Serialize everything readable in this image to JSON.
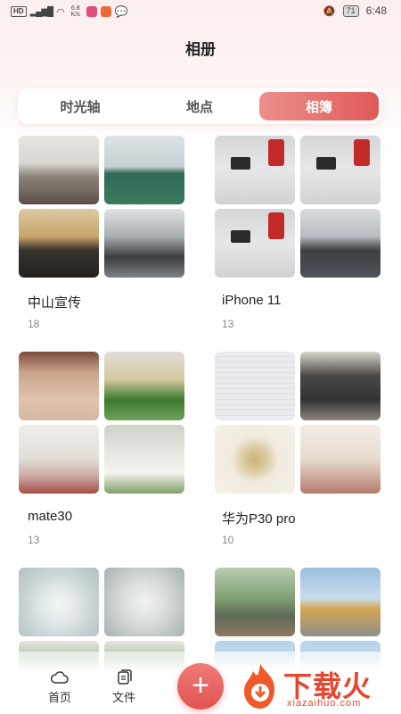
{
  "status_bar": {
    "hd": "HD",
    "signal": "⁴ᴳ",
    "speed_value": "6.8",
    "speed_unit": "K/s",
    "battery": "71",
    "time": "6:48"
  },
  "page_title": "相册",
  "tabs": [
    {
      "label": "时光轴",
      "active": false
    },
    {
      "label": "地点",
      "active": false
    },
    {
      "label": "相簿",
      "active": true
    }
  ],
  "albums": [
    {
      "name": "中山宣传",
      "count": "18"
    },
    {
      "name": "iPhone 11",
      "count": "13"
    },
    {
      "name": "mate30",
      "count": "13"
    },
    {
      "name": "华为P30 pro",
      "count": "10"
    }
  ],
  "bottom_nav": {
    "home_label": "首页",
    "files_label": "文件",
    "add_symbol": "+"
  },
  "watermark": {
    "text": "下载火",
    "url": "xiazaihuo.com"
  },
  "colors": {
    "accent": "#e05451",
    "tab_active_start": "#ec8f8c",
    "tab_active_end": "#df5a58"
  }
}
